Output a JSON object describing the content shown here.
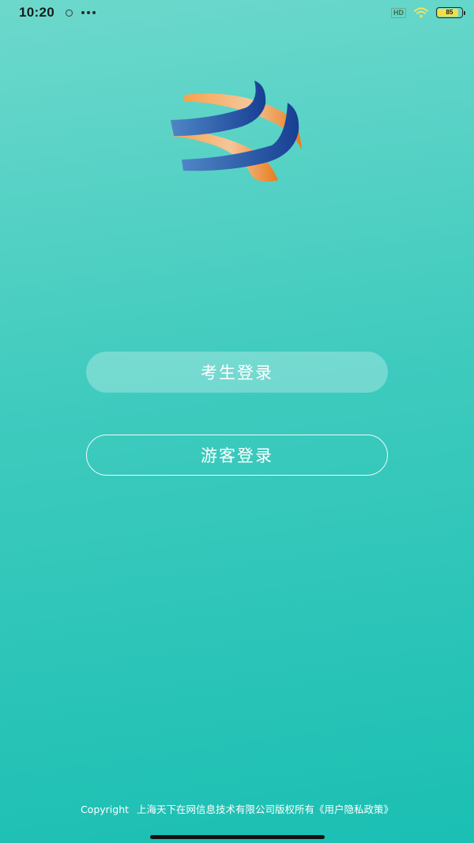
{
  "status_bar": {
    "time": "10:20",
    "hd_label": "HD",
    "battery_text": "85",
    "battery_level": 0.85,
    "icons": [
      "notification-dot-icon",
      "more-icon",
      "hd-icon",
      "wifi-icon",
      "battery-icon"
    ]
  },
  "logo": {
    "icon": "ribbon-logo-icon",
    "colors": {
      "blue": "#1f4fa0",
      "orange": "#f08a28"
    }
  },
  "buttons": {
    "student_login": "考生登录",
    "guest_login": "游客登录"
  },
  "footer": {
    "copyright_label": "Copyright",
    "company": "上海天下在网信息技术有限公司版权所有",
    "privacy_link": "《用户隐私政策》"
  },
  "theme": {
    "gradient_top": "#6dd8cc",
    "gradient_bottom": "#1bbfb3"
  }
}
